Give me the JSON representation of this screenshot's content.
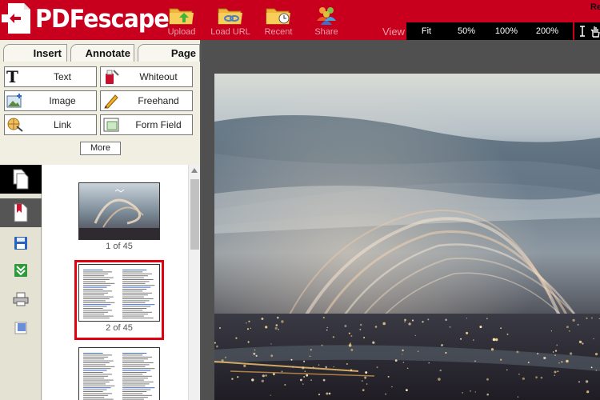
{
  "app": {
    "logo_text": "PDFescape",
    "user_initial": "Re"
  },
  "toolbar": {
    "upload": "Upload",
    "load_url": "Load URL",
    "recent": "Recent",
    "share": "Share"
  },
  "view": {
    "label": "View",
    "zoom_options": [
      "Fit",
      "50%",
      "100%",
      "200%"
    ]
  },
  "tabs": {
    "insert": "Insert",
    "annotate": "Annotate",
    "page": "Page"
  },
  "tools": {
    "text": "Text",
    "whiteout": "Whiteout",
    "image": "Image",
    "freehand": "Freehand",
    "link": "Link",
    "form_field": "Form Field",
    "more": "More"
  },
  "thumbnails": [
    {
      "label": "1 of 45"
    },
    {
      "label": "2 of 45"
    },
    {
      "label": ""
    }
  ],
  "colors": {
    "brand": "#c8001e",
    "selection": "#e1000f"
  }
}
